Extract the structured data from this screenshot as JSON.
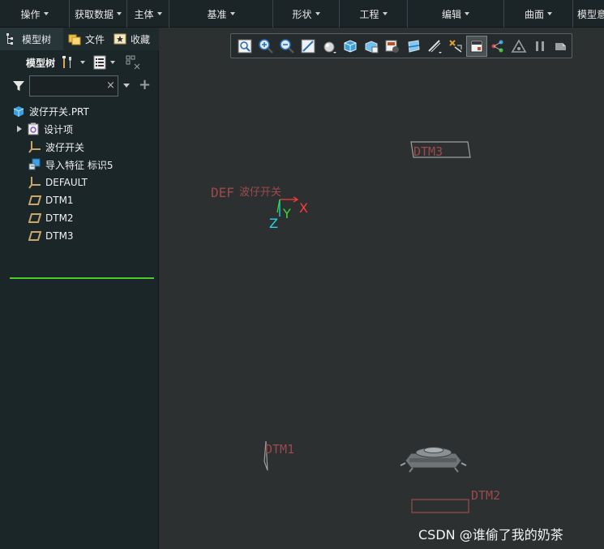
{
  "ribbon": {
    "groups": [
      {
        "label": "操作"
      },
      {
        "label": "获取数据"
      },
      {
        "label": "主体"
      },
      {
        "label": "基准"
      },
      {
        "label": "形状"
      },
      {
        "label": "工程"
      },
      {
        "label": "编辑"
      },
      {
        "label": "曲面"
      },
      {
        "label": "模型意"
      }
    ]
  },
  "navigator": {
    "tabs": [
      {
        "label": "模型树",
        "icon": "model-tree-icon"
      },
      {
        "label": "文件",
        "icon": "folder-icon"
      },
      {
        "label": "收藏",
        "icon": "favorites-icon"
      }
    ],
    "tree_toolbar_label": "模型树",
    "filter": {
      "value": "",
      "clear": "×",
      "add": "+"
    }
  },
  "tree": {
    "items": [
      {
        "label": "波仔开关.PRT",
        "icon": "part-icon"
      },
      {
        "label": "设计项",
        "icon": "design-items-icon",
        "expandable": true
      },
      {
        "label": "波仔开关",
        "icon": "coordinate-system-icon"
      },
      {
        "label": "导入特征 标识5",
        "icon": "import-feature-icon"
      },
      {
        "label": "DEFAULT",
        "icon": "coordinate-system-icon"
      },
      {
        "label": "DTM1",
        "icon": "datum-plane-icon"
      },
      {
        "label": "DTM2",
        "icon": "datum-plane-icon"
      },
      {
        "label": "DTM3",
        "icon": "datum-plane-icon"
      }
    ]
  },
  "graphics": {
    "labels": {
      "dtm3": "DTM3",
      "dtm1": "DTM1",
      "dtm2": "DTM2",
      "csys_default": "DEF",
      "csys_name": "波仔开关",
      "axis_x": "X",
      "axis_y": "Y",
      "axis_z": "Z"
    },
    "colors": {
      "datum": "#9b4a4e",
      "axis_x": "#ff3b3b",
      "axis_y": "#33dd33",
      "axis_z": "#22d6e6",
      "selection_line": "#4ccc2c"
    }
  },
  "watermark": "CSDN @谁偷了我的奶茶"
}
